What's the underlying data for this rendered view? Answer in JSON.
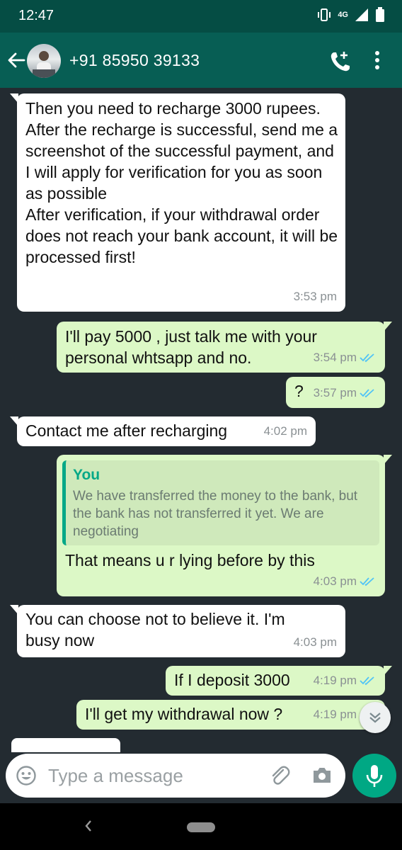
{
  "status_bar": {
    "time": "12:47",
    "network": "4G"
  },
  "header": {
    "contact": "+91 85950 39133"
  },
  "messages": [
    {
      "dir": "in",
      "text": "Then you need to recharge 3000 rupees. After the recharge is successful, send me a screenshot of the successful payment, and I will apply for verification for you as soon as possible\nAfter verification, if your withdrawal order does not reach your bank account, it will be processed first!",
      "time": "3:53 pm"
    },
    {
      "dir": "out",
      "text": "I'll pay 5000 , just talk me with your personal whtsapp and no.",
      "time": "3:54 pm",
      "read": true
    },
    {
      "dir": "out",
      "text": "?",
      "time": "3:57 pm",
      "read": true
    },
    {
      "dir": "in",
      "text": "Contact me after recharging",
      "time": "4:02 pm"
    },
    {
      "dir": "out",
      "quote_name": "You",
      "quote_text": "We have transferred the money to the bank, but the bank has not transferred it yet. We are negotiating",
      "text": "That means u r lying before by this",
      "time": "4:03 pm",
      "read": true
    },
    {
      "dir": "in",
      "text": "You can choose not to believe it. I'm busy now",
      "time": "4:03 pm"
    },
    {
      "dir": "out",
      "text": "If I deposit 3000",
      "time": "4:19 pm",
      "read": true
    },
    {
      "dir": "out",
      "text": "I'll get my withdrawal now ?",
      "time": "4:19 pm",
      "read": true
    }
  ],
  "input": {
    "placeholder": "Type a message"
  },
  "icons": {
    "back": "arrow-left-icon",
    "call": "add-call-icon",
    "more": "more-vert-icon",
    "emoji": "emoji-icon",
    "attach": "paperclip-icon",
    "camera": "camera-icon",
    "mic": "mic-icon",
    "scroll": "double-chevron-down-icon",
    "read": "double-check-icon"
  },
  "colors": {
    "header": "#075e54",
    "status_bar": "#054d44",
    "chat_bg": "#232b31",
    "incoming": "#ffffff",
    "outgoing": "#dcf8c6",
    "accent": "#00a884",
    "read_tick": "#4fc3f7"
  }
}
